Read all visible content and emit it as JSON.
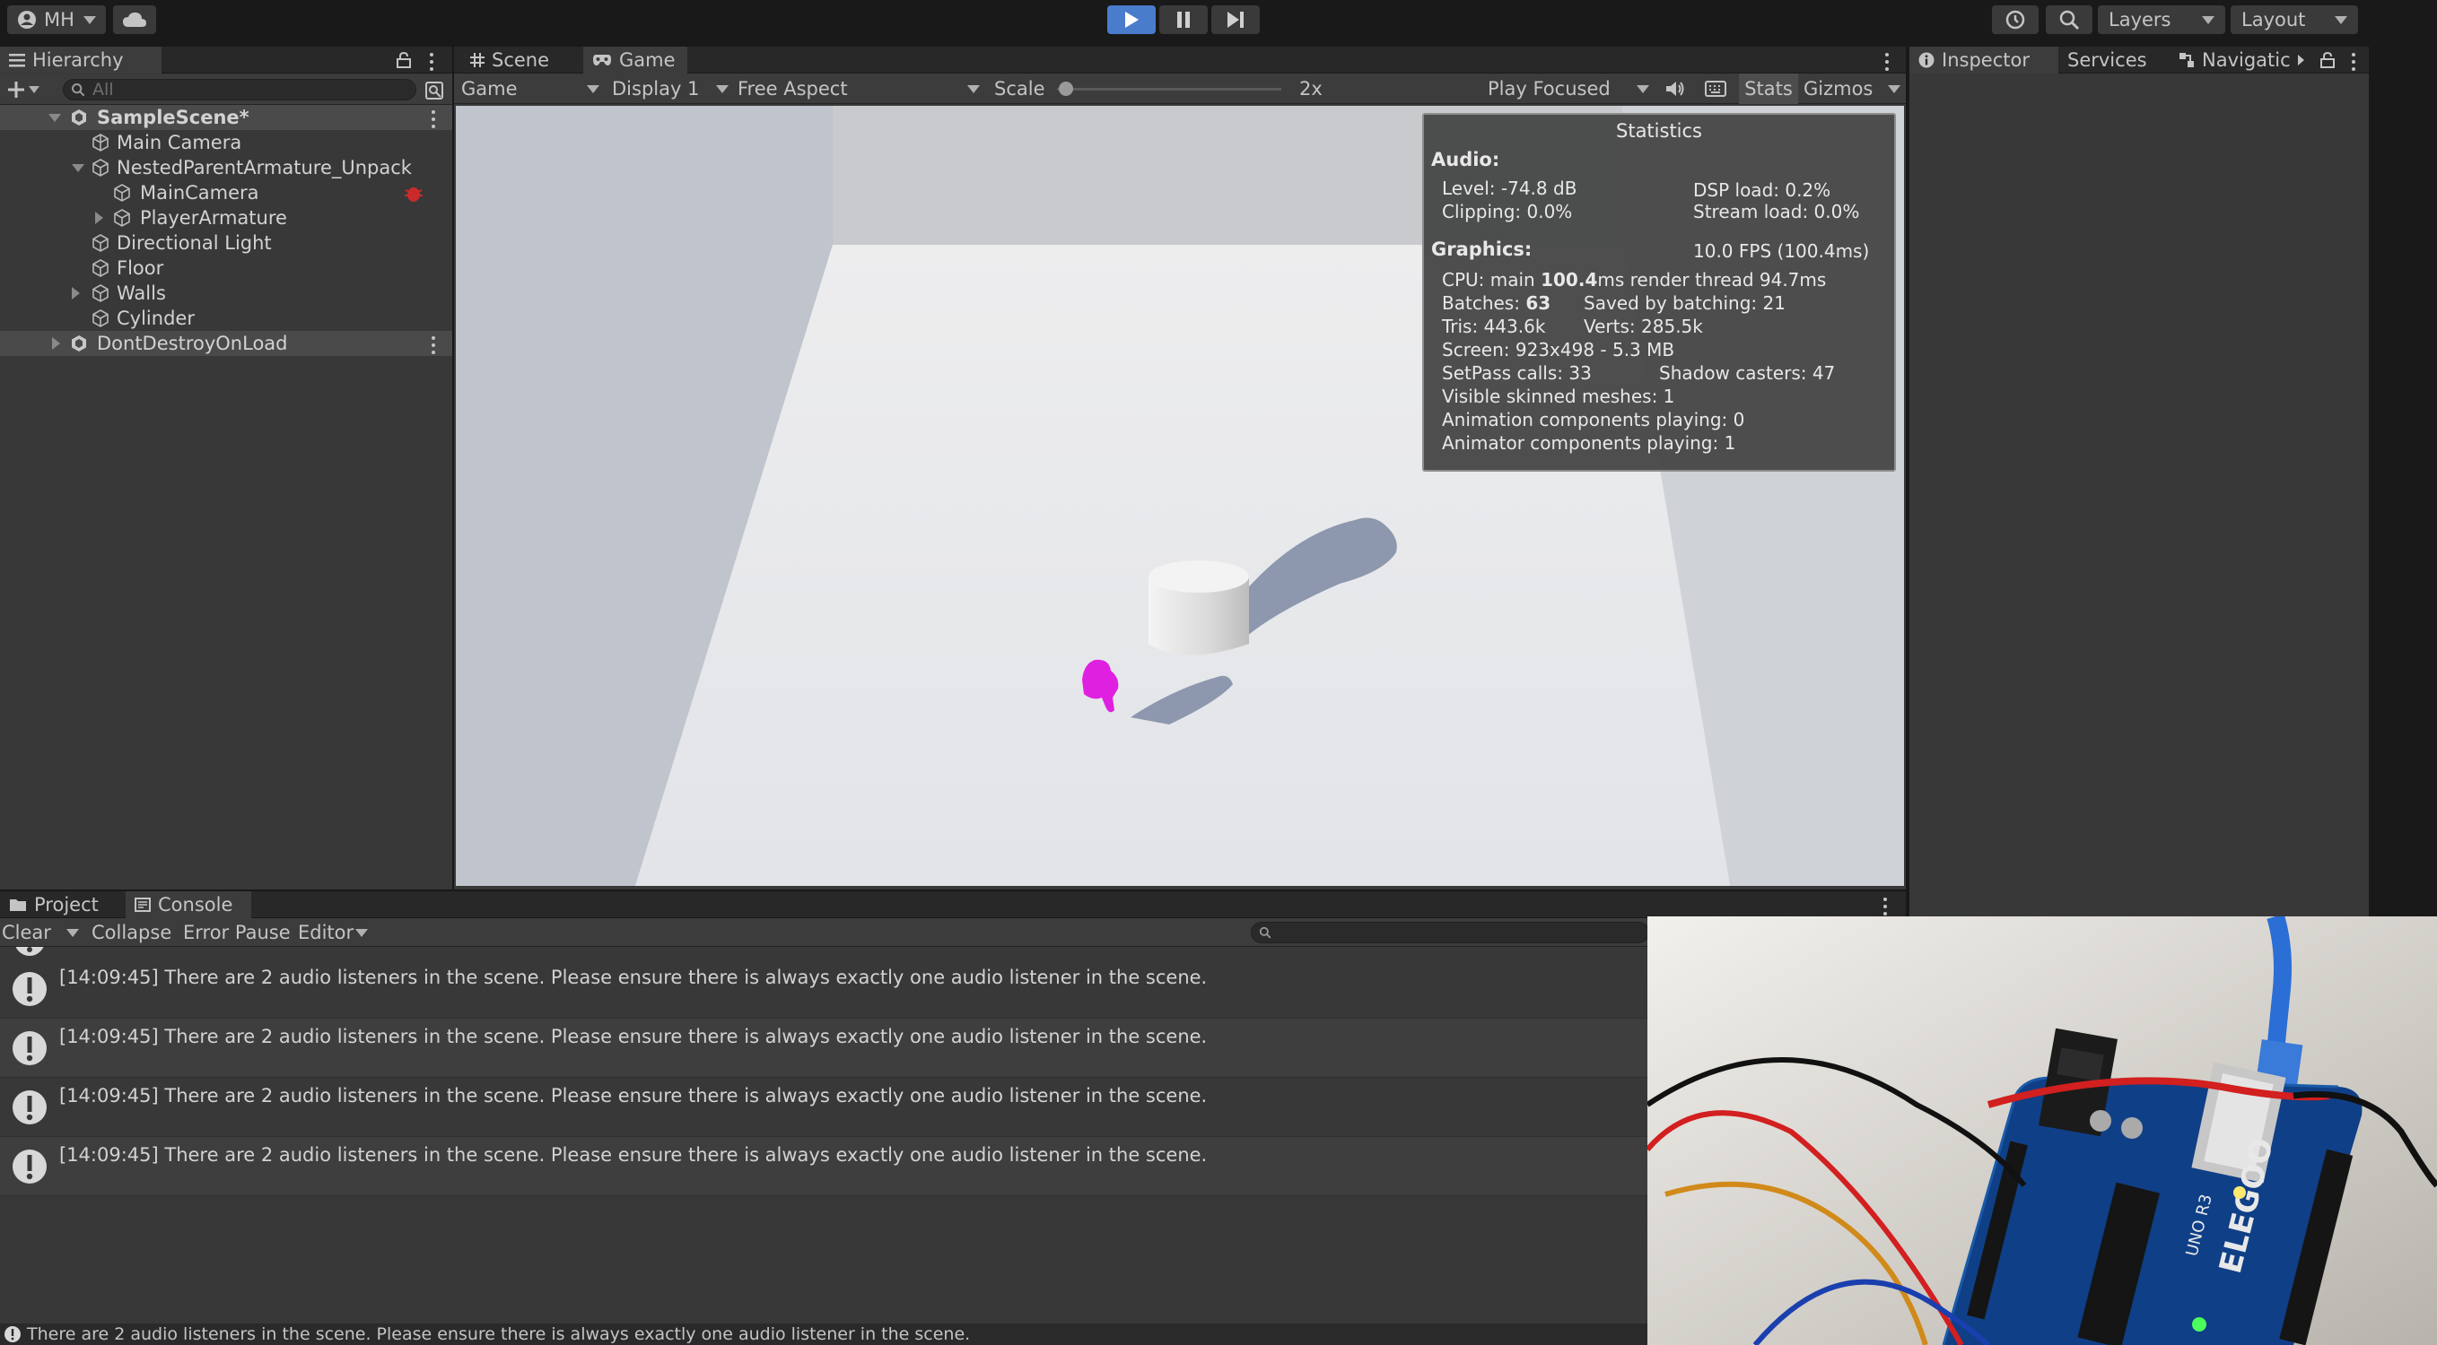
{
  "toolbar": {
    "account_label": "MH",
    "layers_label": "Layers",
    "layout_label": "Layout"
  },
  "hierarchy": {
    "tab_label": "Hierarchy",
    "search_placeholder": "All",
    "items": [
      {
        "label": "SampleScene*"
      },
      {
        "label": "Main Camera"
      },
      {
        "label": "NestedParentArmature_Unpack"
      },
      {
        "label": "MainCamera"
      },
      {
        "label": "PlayerArmature"
      },
      {
        "label": "Directional Light"
      },
      {
        "label": "Floor"
      },
      {
        "label": "Walls"
      },
      {
        "label": "Cylinder"
      },
      {
        "label": "DontDestroyOnLoad"
      }
    ]
  },
  "game_view": {
    "tabs": [
      {
        "label": "Scene"
      },
      {
        "label": "Game"
      }
    ],
    "view_mode": "Game",
    "display": "Display 1",
    "aspect": "Free Aspect",
    "scale_label": "Scale",
    "scale_value": "2x",
    "play_mode": "Play Focused",
    "stats_label": "Stats",
    "gizmos_label": "Gizmos"
  },
  "statistics": {
    "title": "Statistics",
    "audio_heading": "Audio:",
    "level": "Level: -74.8 dB",
    "dsp_load": "DSP load: 0.2%",
    "clipping": "Clipping: 0.0%",
    "stream_load": "Stream load: 0.0%",
    "graphics_heading": "Graphics:",
    "fps": "10.0 FPS (100.4ms)",
    "cpu_prefix": "CPU: main ",
    "cpu_main": "100.4",
    "cpu_suffix": "ms  render thread 94.7ms",
    "batches_prefix": "Batches: ",
    "batches": "63",
    "saved_by_batching": "Saved by batching: 21",
    "tris": "Tris: 443.6k",
    "verts": "Verts: 285.5k",
    "screen": "Screen: 923x498 - 5.3 MB",
    "setpass": "SetPass calls: 33",
    "shadow_casters": "Shadow casters: 47",
    "skinned_meshes": "Visible skinned meshes: 1",
    "animation_components": "Animation components playing: 0",
    "animator_components": "Animator components playing: 1"
  },
  "inspector": {
    "tabs": [
      {
        "label": "Inspector"
      },
      {
        "label": "Services"
      },
      {
        "label": "Navigatic"
      }
    ]
  },
  "console": {
    "tabs": [
      {
        "label": "Project"
      },
      {
        "label": "Console"
      }
    ],
    "clear_label": "Clear",
    "collapse_label": "Collapse",
    "error_pause_label": "Error Pause",
    "editor_label": "Editor",
    "messages": [
      {
        "text": "[14:09:45] There are 2 audio listeners in the scene. Please ensure there is always exactly one audio listener in the scene."
      },
      {
        "text": "[14:09:45] There are 2 audio listeners in the scene. Please ensure there is always exactly one audio listener in the scene."
      },
      {
        "text": "[14:09:45] There are 2 audio listeners in the scene. Please ensure there is always exactly one audio listener in the scene."
      },
      {
        "text": "[14:09:45] There are 2 audio listeners in the scene. Please ensure there is always exactly one audio listener in the scene."
      }
    ]
  },
  "status_bar": {
    "message": "There are 2 audio listeners in the scene. Please ensure there is always exactly one audio listener in the scene."
  },
  "webcam": {
    "board_brand": "ELEGOO",
    "board_model": "UNO R3"
  },
  "colors": {
    "accent": "#4a7ccc",
    "player_missing_material": "#e020e0",
    "warning_icon": "#d8d8d8"
  }
}
